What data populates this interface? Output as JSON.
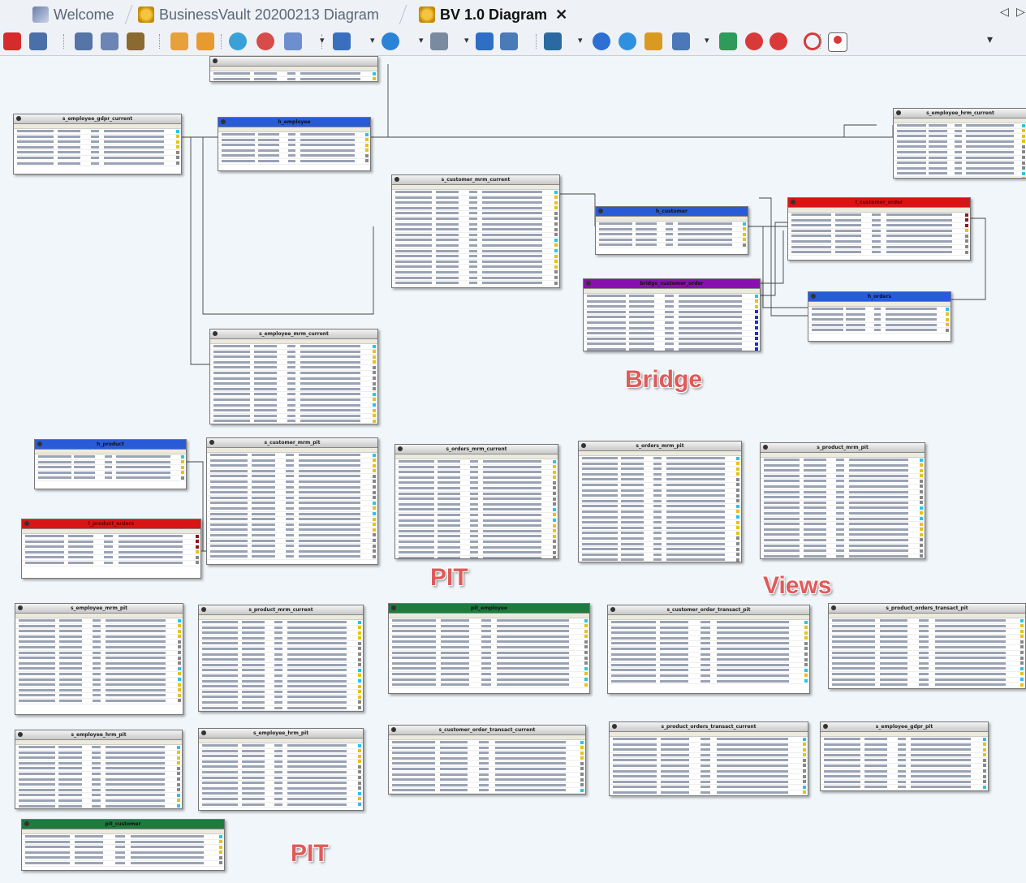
{
  "tabs": [
    {
      "label": "Welcome"
    },
    {
      "label": "BusinessVault 20200213 Diagram"
    },
    {
      "label": "BV 1.0 Diagram"
    }
  ],
  "close_glyph": "✕",
  "nav_glyphs": {
    "left": "◁",
    "right": "▷"
  },
  "dropdown_glyph": "▾",
  "toolbar_icons": [
    "pdf-icon",
    "print-icon",
    "cut-icon",
    "copy-icon",
    "paste-icon",
    "hand-icon",
    "grab-icon",
    "zoom-in-icon",
    "zoom-out-icon",
    "zoom-icon",
    "pencil-icon",
    "refresh-icon",
    "relation-icon",
    "table-icon",
    "layout-icon",
    "hierarchy-icon",
    "link-icon",
    "sphere-icon",
    "keys-icon",
    "grid-icon",
    "split-icon",
    "search-icon",
    "stop-icon",
    "circle-icon",
    "pin-icon"
  ],
  "annotations": [
    {
      "text": "Bridge"
    },
    {
      "text": "PIT"
    },
    {
      "text": "Views"
    },
    {
      "text": "PIT"
    }
  ],
  "entities": [
    {
      "name": "",
      "color": "#d0d0d0",
      "rows": 5
    },
    {
      "name": "s_employee_gdpr_current",
      "color": "#d0d0d0",
      "rows": 7
    },
    {
      "name": "h_employee",
      "color": "#2a5bd7",
      "rows": 6
    },
    {
      "name": "s_employee_hrm_current",
      "color": "#d0d0d0",
      "rows": 11
    },
    {
      "name": "s_customer_mrm_current",
      "color": "#d0d0d0",
      "rows": 18
    },
    {
      "name": "h_customer",
      "color": "#2a5bd7",
      "rows": 5
    },
    {
      "name": "l_customer_order",
      "color": "#d81414",
      "rows": 8
    },
    {
      "name": "bridge_customer_order",
      "color": "#8a0fb0",
      "rows": 12
    },
    {
      "name": "h_orders",
      "color": "#2a5bd7",
      "rows": 5
    },
    {
      "name": "s_employee_mrm_current",
      "color": "#d0d0d0",
      "rows": 15
    },
    {
      "name": "h_product",
      "color": "#2a5bd7",
      "rows": 5
    },
    {
      "name": "s_customer_mrm_pit",
      "color": "#d0d0d0",
      "rows": 20
    },
    {
      "name": "s_orders_mrm_current",
      "color": "#d0d0d0",
      "rows": 20
    },
    {
      "name": "s_orders_mrm_pit",
      "color": "#d0d0d0",
      "rows": 21
    },
    {
      "name": "s_product_mrm_pit",
      "color": "#d0d0d0",
      "rows": 20
    },
    {
      "name": "l_product_orders",
      "color": "#d81414",
      "rows": 6
    },
    {
      "name": "s_employee_mrm_pit",
      "color": "#d0d0d0",
      "rows": 16
    },
    {
      "name": "s_product_mrm_current",
      "color": "#d0d0d0",
      "rows": 17
    },
    {
      "name": "pit_employee",
      "color": "#1f7a3e",
      "rows": 13
    },
    {
      "name": "s_customer_order_transact_pit",
      "color": "#d0d0d0",
      "rows": 12
    },
    {
      "name": "s_product_orders_transact_pit",
      "color": "#d0d0d0",
      "rows": 13
    },
    {
      "name": "s_employee_hrm_pit",
      "color": "#d0d0d0",
      "rows": 12
    },
    {
      "name": "s_employee_hrm_pit",
      "color": "#d0d0d0",
      "rows": 12
    },
    {
      "name": "s_customer_order_transact_current",
      "color": "#d0d0d0",
      "rows": 10
    },
    {
      "name": "s_product_orders_transact_current",
      "color": "#d0d0d0",
      "rows": 11
    },
    {
      "name": "s_employee_gdpr_pit",
      "color": "#d0d0d0",
      "rows": 10
    },
    {
      "name": "pit_customer",
      "color": "#1f7a3e",
      "rows": 6
    }
  ]
}
